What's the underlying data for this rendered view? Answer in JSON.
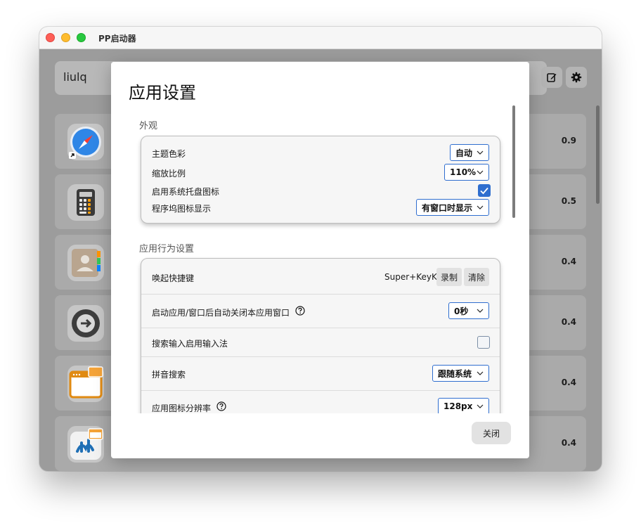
{
  "window": {
    "title": "PP启动器"
  },
  "search": {
    "value": "liulq"
  },
  "toolbar": {
    "edit_icon": "edit-icon",
    "settings_icon": "gear-icon"
  },
  "apps": [
    {
      "icon": "safari-icon",
      "score": "0.9"
    },
    {
      "icon": "calculator-icon",
      "score": "0.5"
    },
    {
      "icon": "contacts-icon",
      "score": "0.4"
    },
    {
      "icon": "arrow-right-circle-icon",
      "score": "0.4"
    },
    {
      "icon": "window-folder-icon",
      "score": "0.4"
    },
    {
      "icon": "vscode-window-icon",
      "score": "0.4"
    }
  ],
  "settings": {
    "title": "应用设置",
    "appearance": {
      "label": "外观",
      "theme": {
        "label": "主题色彩",
        "value": "自动"
      },
      "scale": {
        "label": "缩放比例",
        "value": "110%"
      },
      "tray": {
        "label": "启用系统托盘图标",
        "checked": true
      },
      "dock": {
        "label": "程序坞图标显示",
        "value": "有窗口时显示"
      }
    },
    "behavior": {
      "label": "应用行为设置",
      "hotkey": {
        "label": "唤起快捷键",
        "value": "Super+KeyK",
        "record": "录制",
        "clear": "清除"
      },
      "autoclose": {
        "label": "启动应用/窗口后自动关闭本应用窗口",
        "value": "0秒"
      },
      "ime": {
        "label": "搜索输入启用输入法",
        "checked": false
      },
      "pinyin": {
        "label": "拼音搜索",
        "value": "跟随系统"
      },
      "icon_res": {
        "label": "应用图标分辨率",
        "value": "128px"
      }
    },
    "close": "关闭"
  },
  "colors": {
    "accent": "#2f6ecf",
    "backdrop": "#9c9c9c"
  }
}
